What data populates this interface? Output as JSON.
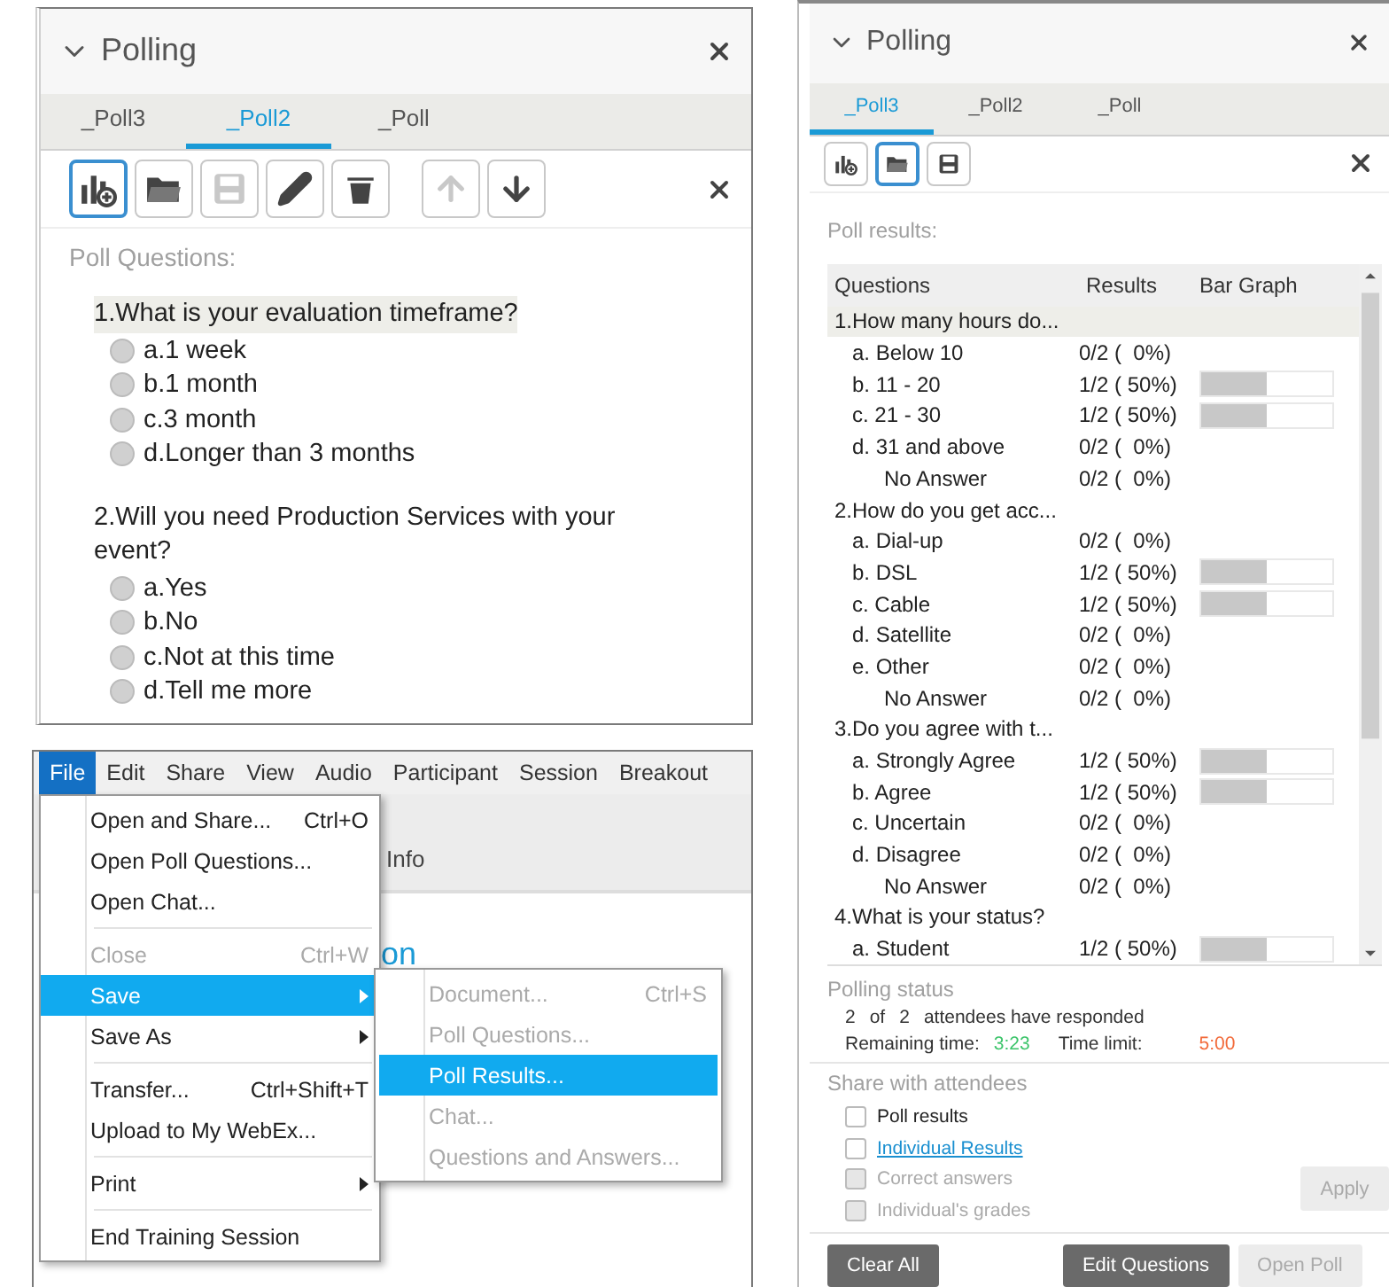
{
  "question_panel": {
    "title": "Polling",
    "tabs": [
      {
        "label": "_Poll3",
        "selected": false
      },
      {
        "label": "_Poll2",
        "selected": true
      },
      {
        "label": "_Poll",
        "selected": false
      }
    ],
    "toolbar": [
      {
        "kind": "new-poll",
        "selected": true,
        "disabled": false
      },
      {
        "kind": "open",
        "selected": false,
        "disabled": false
      },
      {
        "kind": "save",
        "selected": false,
        "disabled": true
      },
      {
        "kind": "edit",
        "selected": false,
        "disabled": false
      },
      {
        "kind": "delete",
        "selected": false,
        "disabled": false
      },
      {
        "kind": "move-up",
        "selected": false,
        "disabled": true
      },
      {
        "kind": "move-down",
        "selected": false,
        "disabled": false
      }
    ],
    "section_label": "Poll Questions:",
    "questions": [
      {
        "text": "1.What is your evaluation timeframe?",
        "highlighted": true,
        "options": [
          {
            "label": "a.1 week",
            "selected": false
          },
          {
            "label": "b.1 month",
            "selected": false
          },
          {
            "label": "c.3 month",
            "selected": false
          },
          {
            "label": "d.Longer than 3 months",
            "selected": false
          }
        ]
      },
      {
        "text": "2.Will you need Production Services with your event?",
        "highlighted": false,
        "options": [
          {
            "label": "a.Yes",
            "selected": false
          },
          {
            "label": "b.No",
            "selected": false
          },
          {
            "label": "c.Not at this time",
            "selected": false
          },
          {
            "label": "d.Tell me more",
            "selected": false
          }
        ]
      }
    ]
  },
  "file_menu": {
    "menubar": [
      {
        "label": "File",
        "selected": true
      },
      {
        "label": "Edit",
        "selected": false
      },
      {
        "label": "Share",
        "selected": false
      },
      {
        "label": "View",
        "selected": false
      },
      {
        "label": "Audio",
        "selected": false
      },
      {
        "label": "Participant",
        "selected": false
      },
      {
        "label": "Session",
        "selected": false
      },
      {
        "label": "Breakout",
        "selected": false
      }
    ],
    "background": {
      "tab_label": "Info",
      "heading": "on"
    },
    "items": [
      {
        "kind": "item",
        "label": "Open and Share...",
        "shortcut": "Ctrl+O",
        "disabled": false,
        "selected": false,
        "submenu": false
      },
      {
        "kind": "item",
        "label": "Open Poll Questions...",
        "disabled": false,
        "selected": false,
        "submenu": false
      },
      {
        "kind": "item",
        "label": "Open Chat...",
        "disabled": false,
        "selected": false,
        "submenu": false
      },
      {
        "kind": "separator"
      },
      {
        "kind": "item",
        "label": "Close",
        "shortcut": "Ctrl+W",
        "disabled": true,
        "selected": false,
        "submenu": false
      },
      {
        "kind": "item",
        "label": "Save",
        "disabled": false,
        "selected": true,
        "submenu": true
      },
      {
        "kind": "item",
        "label": "Save As",
        "disabled": false,
        "selected": false,
        "submenu": true
      },
      {
        "kind": "separator"
      },
      {
        "kind": "item",
        "label": "Transfer...",
        "shortcut": "Ctrl+Shift+T",
        "disabled": false,
        "selected": false,
        "submenu": false
      },
      {
        "kind": "item",
        "label": "Upload to My WebEx...",
        "disabled": false,
        "selected": false,
        "submenu": false
      },
      {
        "kind": "separator"
      },
      {
        "kind": "item",
        "label": "Print",
        "disabled": false,
        "selected": false,
        "submenu": true
      },
      {
        "kind": "separator"
      },
      {
        "kind": "item",
        "label": "End Training Session",
        "disabled": false,
        "selected": false,
        "submenu": false
      }
    ],
    "submenu": [
      {
        "label": "Document...",
        "shortcut": "Ctrl+S",
        "disabled": true,
        "selected": false
      },
      {
        "label": "Poll Questions...",
        "disabled": true,
        "selected": false
      },
      {
        "label": "Poll Results...",
        "disabled": false,
        "selected": true
      },
      {
        "label": "Chat...",
        "disabled": true,
        "selected": false
      },
      {
        "label": "Questions and Answers...",
        "disabled": true,
        "selected": false
      }
    ]
  },
  "results_panel": {
    "title": "Polling",
    "tabs": [
      {
        "label": "_Poll3",
        "selected": true
      },
      {
        "label": "_Poll2",
        "selected": false
      },
      {
        "label": "_Poll",
        "selected": false
      }
    ],
    "toolbar": [
      {
        "kind": "new-poll",
        "selected": false,
        "disabled": false
      },
      {
        "kind": "open",
        "selected": true,
        "disabled": false
      },
      {
        "kind": "save",
        "selected": false,
        "disabled": false
      }
    ],
    "section_label": "Poll results:",
    "columns": [
      "Questions",
      "Results",
      "Bar Graph"
    ],
    "rows": [
      {
        "kind": "question",
        "label": "1.How many hours do...",
        "highlighted": true
      },
      {
        "kind": "answer",
        "label": "a. Below 10",
        "result": "0/2 (  0%)"
      },
      {
        "kind": "answer",
        "label": "b. 11 - 20",
        "result": "1/2 ( 50%)",
        "level": 0.5
      },
      {
        "kind": "answer",
        "label": "c. 21 - 30",
        "result": "1/2 ( 50%)",
        "level": 0.5
      },
      {
        "kind": "answer",
        "label": "d. 31 and above",
        "result": "0/2 (  0%)"
      },
      {
        "kind": "no-answer",
        "label": "No Answer",
        "result": "0/2 (  0%)"
      },
      {
        "kind": "question",
        "label": "2.How do you get acc...",
        "highlighted": false
      },
      {
        "kind": "answer",
        "label": "a. Dial-up",
        "result": "0/2 (  0%)"
      },
      {
        "kind": "answer",
        "label": "b. DSL",
        "result": "1/2 ( 50%)",
        "level": 0.5
      },
      {
        "kind": "answer",
        "label": "c. Cable",
        "result": "1/2 ( 50%)",
        "level": 0.5
      },
      {
        "kind": "answer",
        "label": "d. Satellite",
        "result": "0/2 (  0%)"
      },
      {
        "kind": "answer",
        "label": "e. Other",
        "result": "0/2 (  0%)"
      },
      {
        "kind": "no-answer",
        "label": "No Answer",
        "result": "0/2 (  0%)"
      },
      {
        "kind": "question",
        "label": "3.Do you agree with t...",
        "highlighted": false
      },
      {
        "kind": "answer",
        "label": "a. Strongly Agree",
        "result": "1/2 ( 50%)",
        "level": 0.5
      },
      {
        "kind": "answer",
        "label": "b. Agree",
        "result": "1/2 ( 50%)",
        "level": 0.5
      },
      {
        "kind": "answer",
        "label": "c. Uncertain",
        "result": "0/2 (  0%)"
      },
      {
        "kind": "answer",
        "label": "d. Disagree",
        "result": "0/2 (  0%)"
      },
      {
        "kind": "no-answer",
        "label": "No Answer",
        "result": "0/2 (  0%)"
      },
      {
        "kind": "question",
        "label": "4.What is your status?",
        "highlighted": false
      },
      {
        "kind": "answer",
        "label": "a. Student",
        "result": "1/2 ( 50%)",
        "level": 0.5
      }
    ],
    "status": {
      "heading": "Polling status",
      "responded": "2",
      "of": "of",
      "total": "2",
      "responded_text": "attendees have responded",
      "remaining_label": "Remaining time:",
      "remaining": "3:23",
      "limit_label": "Time limit:",
      "limit": "5:00"
    },
    "share": {
      "heading": "Share with attendees",
      "options": [
        {
          "kind": "text",
          "label": "Poll results",
          "checked": false,
          "disabled": false
        },
        {
          "kind": "link",
          "label": "Individual Results",
          "checked": false,
          "disabled": false
        },
        {
          "kind": "text",
          "label": "Correct answers",
          "checked": false,
          "disabled": true
        },
        {
          "kind": "text",
          "label": "Individual's grades",
          "checked": false,
          "disabled": true
        }
      ],
      "apply": {
        "label": "Apply",
        "disabled": true
      }
    },
    "buttons": [
      {
        "label": "Clear All",
        "disabled": false
      },
      {
        "label": "Edit Questions",
        "disabled": false
      },
      {
        "label": "Open Poll",
        "disabled": true
      }
    ]
  }
}
